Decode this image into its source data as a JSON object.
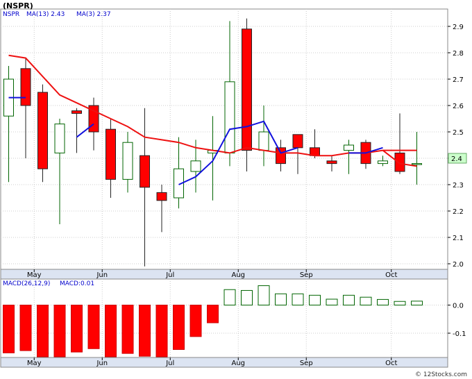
{
  "title": "(NSPR)",
  "price_legend": {
    "ticker": "NSPR",
    "ma13": "MA(13)  2.43",
    "ma3": "MA(3)  2.37"
  },
  "macd_legend": {
    "macd_label": "MACD(26,12,9)",
    "macd_value": "MACD:0.01"
  },
  "last_price_label": "2.4",
  "footer": "© 12Stocks.com",
  "colors": {
    "up": "#006400",
    "down": "#ff0000",
    "ma13": "#ee1111",
    "ma3": "#1111dd",
    "grid": "#cccccc",
    "last_box": "#ccffcc"
  },
  "chart_data": [
    {
      "type": "candlestick",
      "title": "(NSPR)",
      "ylim": [
        1.98,
        2.96
      ],
      "yticks": [
        2.0,
        2.1,
        2.2,
        2.3,
        2.4,
        2.5,
        2.6,
        2.7,
        2.8,
        2.9
      ],
      "x_tick_labels": [
        "May",
        "Jun",
        "Jul",
        "Aug",
        "Sep",
        "Oct"
      ],
      "x_tick_positions": [
        1.5,
        5.5,
        9.5,
        13.5,
        17.5,
        22.5
      ],
      "candles": [
        {
          "open": 2.56,
          "high": 2.75,
          "low": 2.31,
          "close": 2.7
        },
        {
          "open": 2.74,
          "high": 2.78,
          "low": 2.4,
          "close": 2.6
        },
        {
          "open": 2.65,
          "high": 2.68,
          "low": 2.31,
          "close": 2.36
        },
        {
          "open": 2.42,
          "high": 2.55,
          "low": 2.15,
          "close": 2.53
        },
        {
          "open": 2.58,
          "high": 2.59,
          "low": 2.42,
          "close": 2.57
        },
        {
          "open": 2.6,
          "high": 2.63,
          "low": 2.43,
          "close": 2.5
        },
        {
          "open": 2.51,
          "high": 2.55,
          "low": 2.25,
          "close": 2.32
        },
        {
          "open": 2.32,
          "high": 2.5,
          "low": 2.27,
          "close": 2.46
        },
        {
          "open": 2.41,
          "high": 2.59,
          "low": 1.99,
          "close": 2.29
        },
        {
          "open": 2.27,
          "high": 2.3,
          "low": 2.12,
          "close": 2.24
        },
        {
          "open": 2.25,
          "high": 2.48,
          "low": 2.21,
          "close": 2.36
        },
        {
          "open": 2.35,
          "high": 2.47,
          "low": 2.27,
          "close": 2.39
        },
        {
          "open": 2.42,
          "high": 2.56,
          "low": 2.24,
          "close": 2.43
        },
        {
          "open": 2.42,
          "high": 2.92,
          "low": 2.37,
          "close": 2.69
        },
        {
          "open": 2.89,
          "high": 2.93,
          "low": 2.35,
          "close": 2.43
        },
        {
          "open": 2.43,
          "high": 2.6,
          "low": 2.37,
          "close": 2.5
        },
        {
          "open": 2.44,
          "high": 2.47,
          "low": 2.35,
          "close": 2.38
        },
        {
          "open": 2.49,
          "high": 2.49,
          "low": 2.34,
          "close": 2.44
        },
        {
          "open": 2.44,
          "high": 2.51,
          "low": 2.4,
          "close": 2.41
        },
        {
          "open": 2.39,
          "high": 2.41,
          "low": 2.35,
          "close": 2.38
        },
        {
          "open": 2.43,
          "high": 2.47,
          "low": 2.34,
          "close": 2.45
        },
        {
          "open": 2.46,
          "high": 2.47,
          "low": 2.36,
          "close": 2.38
        },
        {
          "open": 2.38,
          "high": 2.41,
          "low": 2.37,
          "close": 2.39
        },
        {
          "open": 2.42,
          "high": 2.57,
          "low": 2.34,
          "close": 2.35
        },
        {
          "open": 2.38,
          "high": 2.5,
          "low": 2.3,
          "close": 2.38
        }
      ],
      "series": [
        {
          "name": "MA(13)",
          "values": [
            2.79,
            2.78,
            2.71,
            2.64,
            2.61,
            2.58,
            2.55,
            2.52,
            2.48,
            2.47,
            2.46,
            2.44,
            2.43,
            2.42,
            2.44,
            2.43,
            2.42,
            2.42,
            2.41,
            2.41,
            2.42,
            2.42,
            2.43,
            2.43,
            2.43
          ]
        },
        {
          "name": "MA(3)",
          "values": [
            2.63,
            2.63,
            null,
            null,
            2.48,
            2.53,
            null,
            null,
            null,
            null,
            2.3,
            2.33,
            2.39,
            2.51,
            2.52,
            2.54,
            2.42,
            2.44,
            null,
            null,
            2.42,
            2.42,
            2.44,
            null,
            null
          ]
        }
      ],
      "ma13_tail": [
        2.38,
        2.37
      ]
    },
    {
      "type": "bar",
      "title": "MACD(26,12,9)",
      "ylim": [
        -0.235,
        0.085
      ],
      "yticks": [
        -0.1,
        0.0
      ],
      "x_tick_labels": [
        "May",
        "Jun",
        "Jul",
        "Aug",
        "Sep",
        "Oct"
      ],
      "values": [
        -0.17,
        -0.162,
        -0.222,
        -0.205,
        -0.167,
        -0.155,
        -0.19,
        -0.172,
        -0.182,
        -0.203,
        -0.158,
        -0.112,
        -0.063,
        0.055,
        0.052,
        0.069,
        0.04,
        0.04,
        0.035,
        0.021,
        0.035,
        0.028,
        0.02,
        0.013,
        0.014
      ]
    }
  ]
}
